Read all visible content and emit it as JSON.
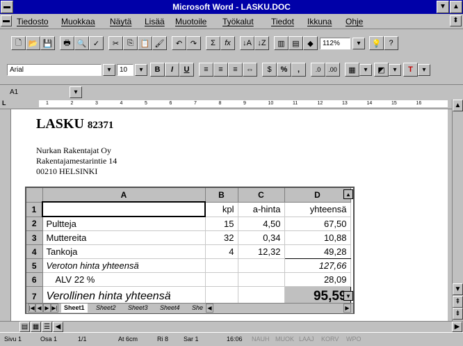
{
  "window": {
    "title": "Microsoft Word - LASKU.DOC"
  },
  "menu": [
    "Tiedosto",
    "Muokkaa",
    "Näytä",
    "Lisää",
    "Muotoile",
    "Työkalut",
    "Tiedot",
    "Ikkuna",
    "Ohje"
  ],
  "toolbar": {
    "zoom": "112%"
  },
  "format": {
    "font": "Arial",
    "size": "10",
    "bold": "B",
    "italic": "I",
    "underline": "U",
    "percent": "%",
    "comma": ","
  },
  "cell_ref": "A1",
  "ruler": {
    "numbers": [
      "1",
      "2",
      "3",
      "4",
      "5",
      "6",
      "7",
      "8",
      "9",
      "10",
      "11",
      "12",
      "13",
      "14",
      "15",
      "16"
    ]
  },
  "document": {
    "title": "LASKU",
    "number": "82371",
    "address": [
      "Nurkan Rakentajat Oy",
      "Rakentajamestarintie 14",
      "00210 HELSINKI"
    ]
  },
  "sheet": {
    "columns": [
      "A",
      "B",
      "C",
      "D"
    ],
    "rows": [
      {
        "n": "1",
        "a": "",
        "b": "kpl",
        "c": "a-hinta",
        "d": "yhteensä"
      },
      {
        "n": "2",
        "a": "Pultteja",
        "b": "15",
        "c": "4,50",
        "d": "67,50"
      },
      {
        "n": "3",
        "a": "Muttereita",
        "b": "32",
        "c": "0,34",
        "d": "10,88"
      },
      {
        "n": "4",
        "a": "Tankoja",
        "b": "4",
        "c": "12,32",
        "d": "49,28"
      },
      {
        "n": "5",
        "a": "Veroton hinta yhteensä",
        "b": "",
        "c": "",
        "d": "127,66"
      },
      {
        "n": "6",
        "a": "ALV 22 %",
        "b": "",
        "c": "",
        "d": "28,09"
      },
      {
        "n": "7",
        "a": "Verollinen hinta yhteensä",
        "b": "",
        "c": "",
        "d": "95,59"
      }
    ],
    "tabs": [
      "Sheet1",
      "Sheet2",
      "Sheet3",
      "Sheet4",
      "She"
    ]
  },
  "status": {
    "page": "Sivu 1",
    "section": "Osa 1",
    "pages": "1/1",
    "at": "At 6cm",
    "line": "Ri 8",
    "col": "Sar 1",
    "time": "16:06",
    "flags": [
      "NAUH",
      "MUOK",
      "LAAJ",
      "KORV",
      "WPO"
    ]
  }
}
